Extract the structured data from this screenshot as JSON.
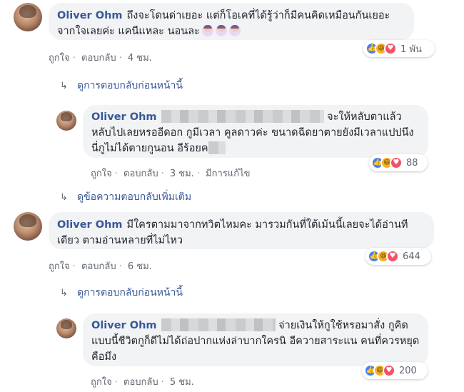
{
  "comments": [
    {
      "author": "Oliver Ohm",
      "text": "ถึงจะโดนด่าเยอะ แต่ก็โอเคที่ได้รู้ว่าก็มีคนคิดเหมือนกันเยอะ จากใจเลยค่ะ แคนีแหละ นอนละ",
      "like_label": "ถูกใจ",
      "reply_label": "ตอบกลับ",
      "time": "4 ชม.",
      "reaction_count": "1 พัน",
      "view_replies": "ดูการตอบกลับก่อนหน้านี้"
    },
    {
      "author": "Oliver Ohm",
      "text": "จะให้หลับตาแล้วหลับไปเลยหรออีดอก กูมีเวลา คูลดาวค่ะ ขนาดฉีดยาตายยังมีเวลาแปปนึง นี่กูไม่ได้ตายกูนอน อีร้อยค",
      "like_label": "ถูกใจ",
      "reply_label": "ตอบกลับ",
      "time": "3 ชม.",
      "edited_label": "มีการแก้ไข",
      "reaction_count": "88",
      "view_more": "ดูข้อความตอบกลับเพิ่มเติม"
    },
    {
      "author": "Oliver Ohm",
      "text": "มีใครตามมาจากทวิตไหมคะ มารวมกันที่ใต้เม้นนี้เลยจะได้อ่านทีเดียว ตามอ่านหลายที่ไม่ไหว",
      "like_label": "ถูกใจ",
      "reply_label": "ตอบกลับ",
      "time": "6 ชม.",
      "reaction_count": "644",
      "view_replies": "ดูการตอบกลับก่อนหน้านี้"
    },
    {
      "author": "Oliver Ohm",
      "text": "จ่ายเงินให้กูใช้หรอมาสั่ง กูคิดแบบนี้ชีวิตกูก็ดีไม่ได้ถ่อปากแห่งล่าบากใครนิ อีควายสาระแน คนที่ควรหยุดคือมึง",
      "like_label": "ถูกใจ",
      "reply_label": "ตอบกลับ",
      "time": "5 ชม.",
      "reaction_count": "200"
    }
  ],
  "icons": {
    "reply_arrow": "↳",
    "like": "👍",
    "haha": "😆",
    "love": "♥"
  },
  "colors": {
    "author": "#385898",
    "bubble": "#f2f3f5",
    "meta": "#606770"
  }
}
